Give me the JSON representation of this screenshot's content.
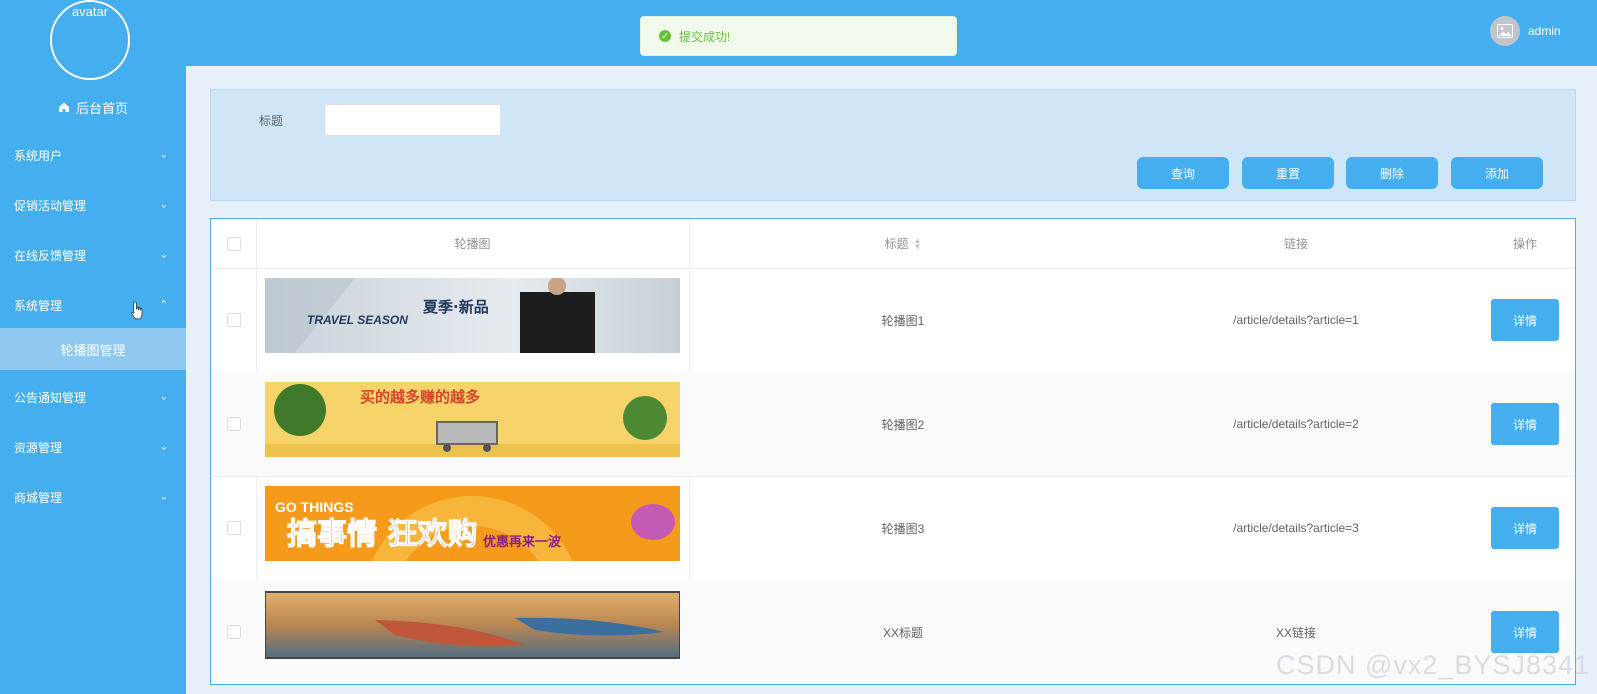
{
  "sidebar": {
    "avatar_text": "avatar",
    "home_label": "后台首页",
    "items": [
      {
        "label": "系统用户"
      },
      {
        "label": "促销活动管理"
      },
      {
        "label": "在线反馈管理"
      },
      {
        "label": "系统管理",
        "expanded": true
      },
      {
        "label": "公告通知管理"
      },
      {
        "label": "资源管理"
      },
      {
        "label": "商城管理"
      }
    ],
    "submenu_active": "轮播图管理"
  },
  "header": {
    "toast_message": "提交成功!",
    "username": "admin"
  },
  "search": {
    "label": "标题",
    "placeholder": "",
    "buttons": {
      "query": "查询",
      "reset": "重置",
      "delete": "删除",
      "add": "添加"
    }
  },
  "table": {
    "headers": {
      "image": "轮播图",
      "title": "标题",
      "link": "链接",
      "action": "操作"
    },
    "rows": [
      {
        "title": "轮播图1",
        "link": "/article/details?article=1",
        "action": "详情",
        "banner_text": "夏季·新品",
        "banner_sub": "TRAVEL SEASON"
      },
      {
        "title": "轮播图2",
        "link": "/article/details?article=2",
        "action": "详情",
        "banner_text": "买的越多赚的越多"
      },
      {
        "title": "轮播图3",
        "link": "/article/details?article=3",
        "action": "详情",
        "banner_text": "搞事情 狂欢购",
        "banner_sub": "GO THINGS",
        "banner_sub2": "优惠再来一波"
      },
      {
        "title": "XX标题",
        "link": "XX链接",
        "action": "详情"
      }
    ]
  },
  "watermark": "CSDN @vx2_BYSJ8341",
  "colors": {
    "primary": "#45aeee",
    "success": "#67c23a"
  }
}
